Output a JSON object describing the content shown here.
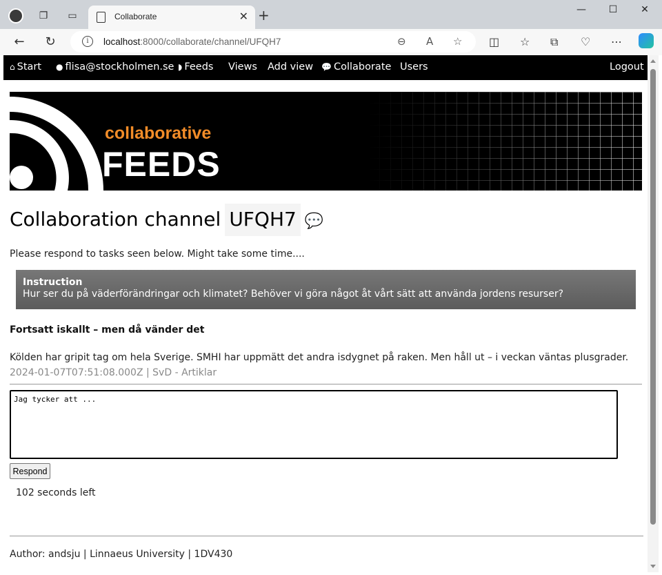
{
  "browser": {
    "tab_title": "Collaborate",
    "url_host": "localhost",
    "url_path": ":8000/collaborate/channel/UFQH7"
  },
  "nav": {
    "start": "Start",
    "user": "flisa@stockholmen.se",
    "feeds": "Feeds",
    "views": "Views",
    "add_view": "Add view",
    "collaborate": "Collaborate",
    "users": "Users",
    "logout": "Logout"
  },
  "banner": {
    "line1": "collaborative",
    "line2": "FEEDS"
  },
  "channel": {
    "heading": "Collaboration channel",
    "code": "UFQH7",
    "intro": "Please respond to tasks seen below. Might take some time...."
  },
  "instruction": {
    "label": "Instruction",
    "text": "Hur ser du på väderförändringar och klimatet? Behöver vi göra något åt vårt sätt att använda jordens resurser?"
  },
  "article": {
    "title": "Fortsatt iskallt – men då vänder det",
    "summary": "Kölden har gripit tag om hela Sverige. SMHI har uppmätt det andra isdygnet på raken. Men håll ut – i veckan väntas plusgrader.",
    "meta": "2024-01-07T07:51:08.000Z | SvD - Artiklar"
  },
  "response": {
    "value": "Jag tycker att ...",
    "button": "Respond",
    "timer": "102 seconds left"
  },
  "footer": {
    "text": "Author: andsju | Linnaeus University | 1DV430"
  }
}
